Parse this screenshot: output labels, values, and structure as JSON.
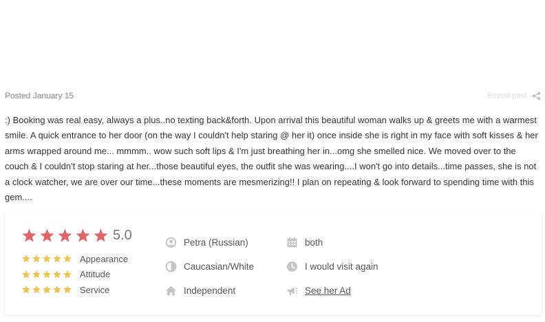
{
  "review": {
    "posted": "Posted January 15",
    "report_label": "Report post",
    "text": ":) Booking was real easy, always a plus..no texting back&forth.  Upon arrival this beautiful woman walks up  & greets me with a warmest smile. A quick entrance to her door (on the way I couldn't help staring @ her it) once inside she is right in my face with soft kisses & her arms wrapped around me... mmmm.. wow such soft lips & I'm just breathing her in...omg she smelled nice.  We moved over to the couch & I couldn't stop staring at her...those beautiful eyes, the outfit she was wearing....I won't go into details...time passes, she is not a clock watcher, we are over our time...these moments are mesmerizing!! I plan on repeating & look forward to spending time with this gem...."
  },
  "ratings": {
    "overall_score": "5.0",
    "overall_stars": 5,
    "categories": [
      {
        "label": "Appearance",
        "stars": 5
      },
      {
        "label": "Attitude",
        "stars": 5
      },
      {
        "label": "Service",
        "stars": 5
      }
    ]
  },
  "details": {
    "name": "Petra (Russian)",
    "ethnicity": "Caucasian/White",
    "type": "Independent",
    "service_mode": "both",
    "verdict": "I would visit again",
    "ad_link": "See her Ad"
  },
  "icons": {
    "share": "share-icon",
    "person": "person-icon",
    "contrast": "contrast-icon",
    "house": "house-icon",
    "calendar": "calendar-icon",
    "clock": "clock-icon",
    "megaphone": "megaphone-icon"
  },
  "colors": {
    "big_star": "#e06666",
    "small_star": "#f1c24b",
    "icon": "#c4c4c4",
    "text": "#333333"
  }
}
